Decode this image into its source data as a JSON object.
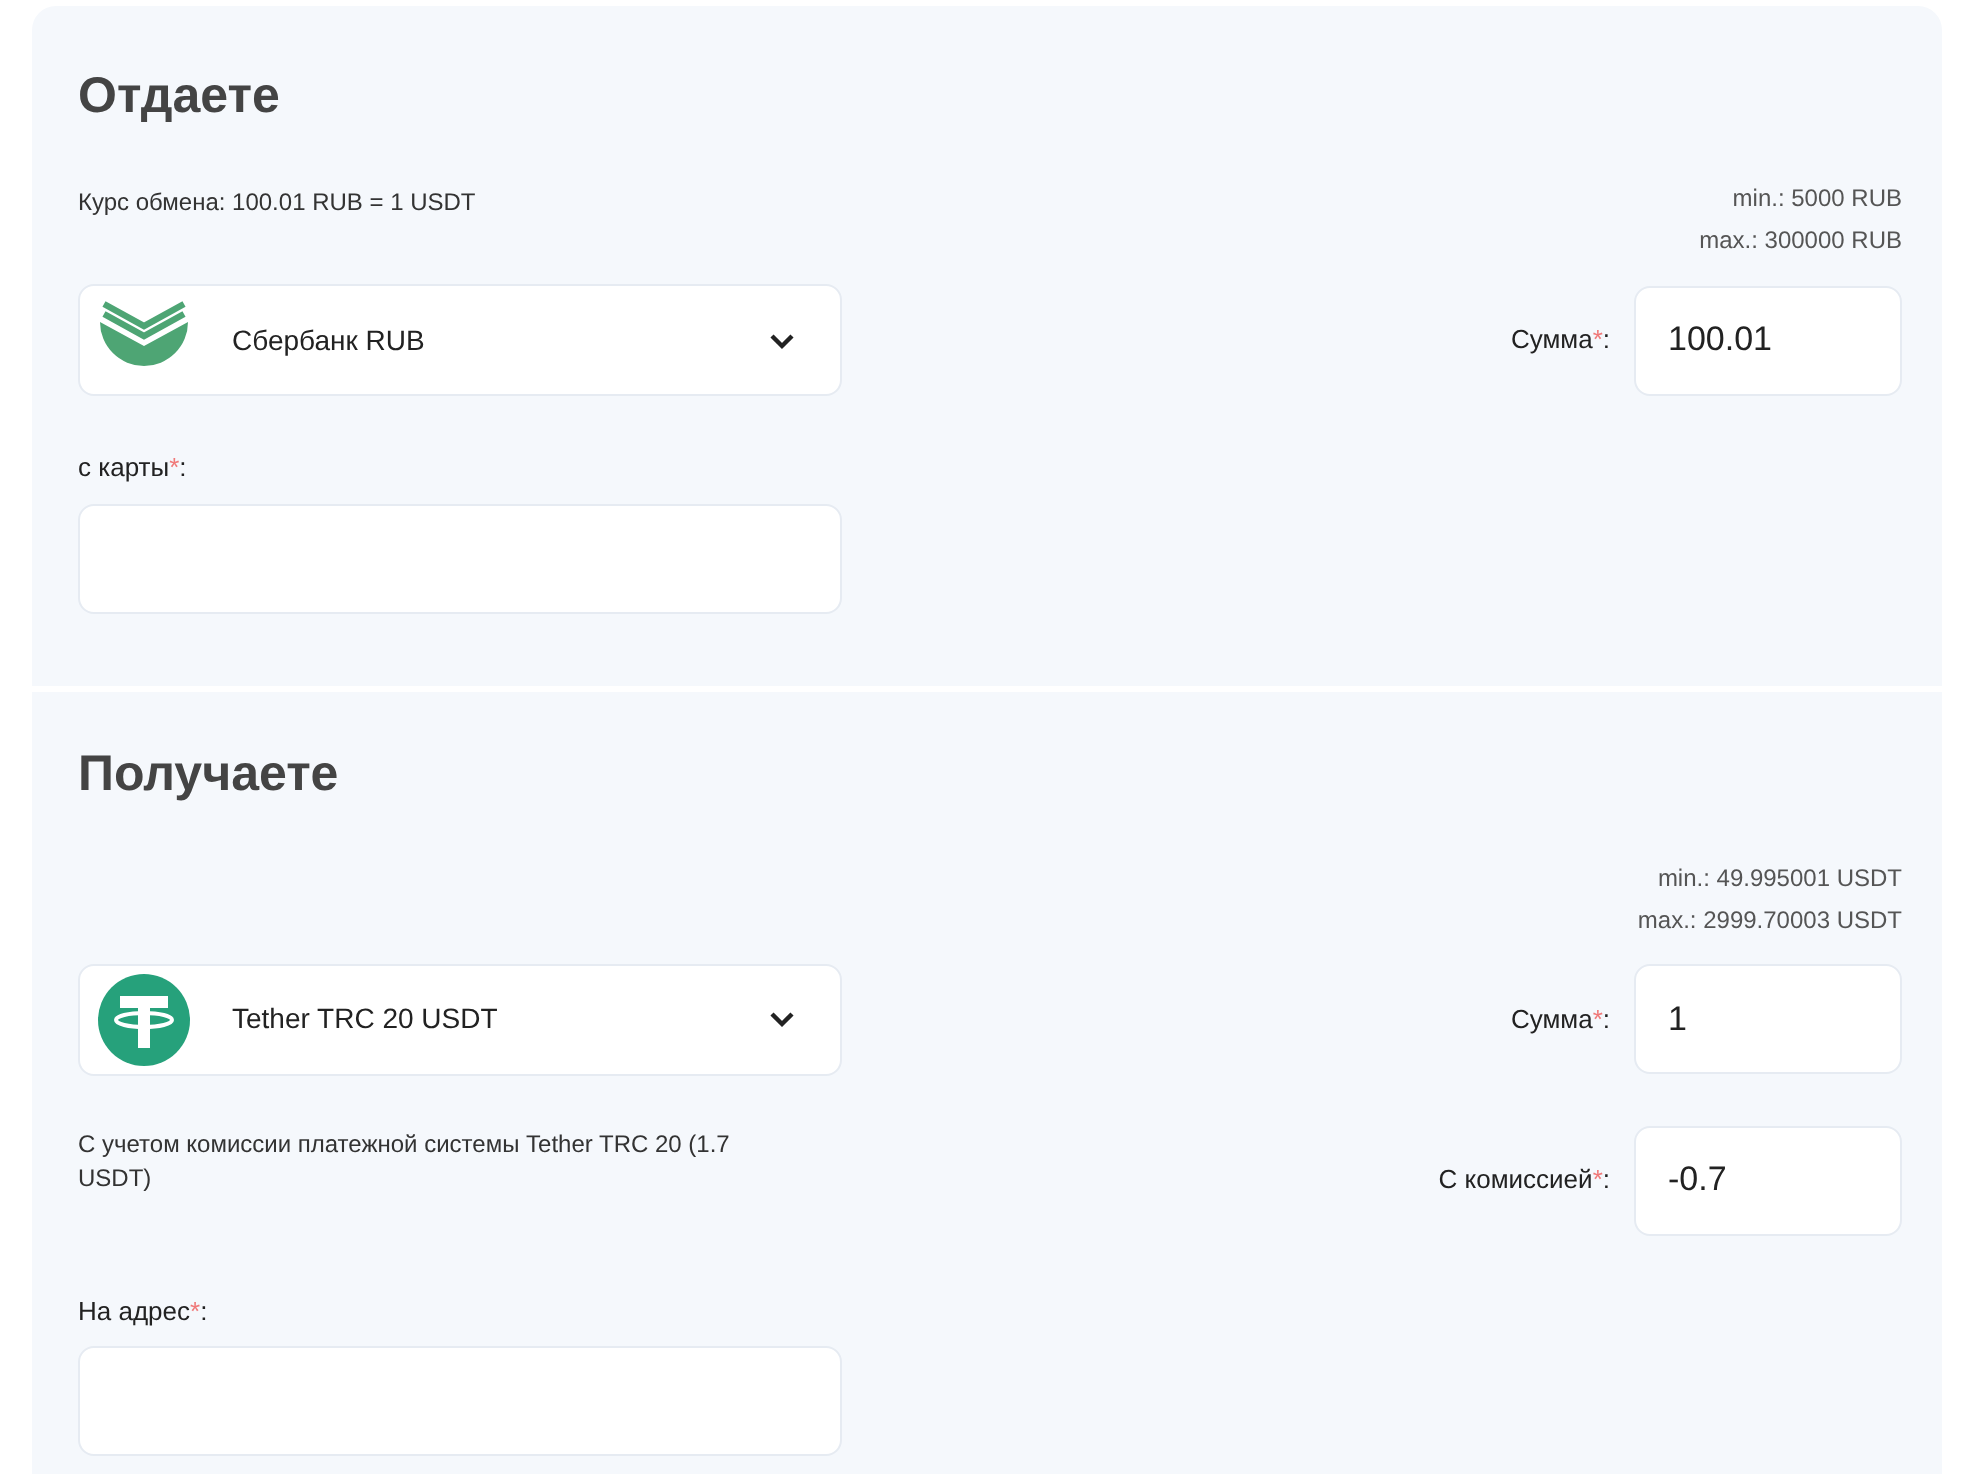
{
  "sections": [
    {
      "heading": "Отдаете",
      "rate": "Курс обмена: 100.01 RUB = 1 USDT",
      "limits": [
        "min.: 5000 RUB",
        "max.: 300000 RUB"
      ],
      "currency": {
        "name": "Сбербанк RUB",
        "kind": "sber"
      },
      "amounts": [
        {
          "label": "Сумма",
          "mark": "*",
          "colon": ":",
          "value": "100.01"
        }
      ],
      "address": {
        "label": "с карты",
        "mark": "*",
        "colon": ":"
      }
    },
    {
      "heading": "Получаете",
      "limits": [
        "min.: 49.995001 USDT",
        "max.: 2999.70003 USDT"
      ],
      "currency": {
        "name": "Tether TRC 20 USDT",
        "kind": "tether"
      },
      "note": "С учетом комиссии платежной системы Tether TRC 20 (1.7 USDT)",
      "amounts": [
        {
          "label": "Сумма",
          "mark": "*",
          "colon": ":",
          "value": "1"
        },
        {
          "label": "С комиссией",
          "mark": "*",
          "colon": ":",
          "value": "-0.7"
        }
      ],
      "address": {
        "label": "На адрес",
        "mark": "*",
        "colon": ":"
      }
    }
  ]
}
